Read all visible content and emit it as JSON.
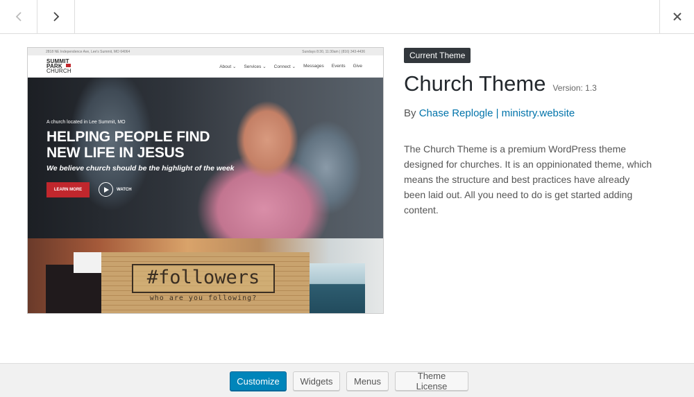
{
  "topbar": {
    "prev_icon": "chevron-left-icon",
    "next_icon": "chevron-right-icon",
    "close_icon": "close-icon"
  },
  "preview": {
    "strip_left": "2818 NE Independence Ave, Lee's Summit, MO 64064",
    "strip_right": "Sundays 8:30, 11:30am | (816) 343-4436",
    "logo": [
      "SUMMIT",
      "PARK",
      "CHURCH"
    ],
    "menu": [
      "About ⌄",
      "Services ⌄",
      "Connect ⌄",
      "Messages",
      "Events",
      "Give"
    ],
    "hero_small": "A church located in Lee Summit, MO",
    "hero_title_1": "HELPING PEOPLE FIND",
    "hero_title_2": "NEW LIFE IN JESUS",
    "hero_sub": "We believe church should be the highlight of the week",
    "learn_more": "LEARN MORE",
    "watch": "WATCH",
    "sign": "#followers",
    "sign_sub": "who are you following?"
  },
  "theme": {
    "badge": "Current Theme",
    "name": "Church Theme",
    "version": "Version: 1.3",
    "by": "By ",
    "author": "Chase Replogle | ministry.website",
    "description": "The Church Theme is a premium WordPress theme designed for churches. It is an oppinionated theme, which means the structure and best practices have already been laid out. All you need to do is get started adding content."
  },
  "footer": {
    "customize": "Customize",
    "widgets": "Widgets",
    "menus": "Menus",
    "license": "Theme License"
  },
  "colors": {
    "primary": "#0085ba",
    "badge": "#32373c",
    "link": "#0073aa",
    "accent_red": "#c1272d"
  }
}
